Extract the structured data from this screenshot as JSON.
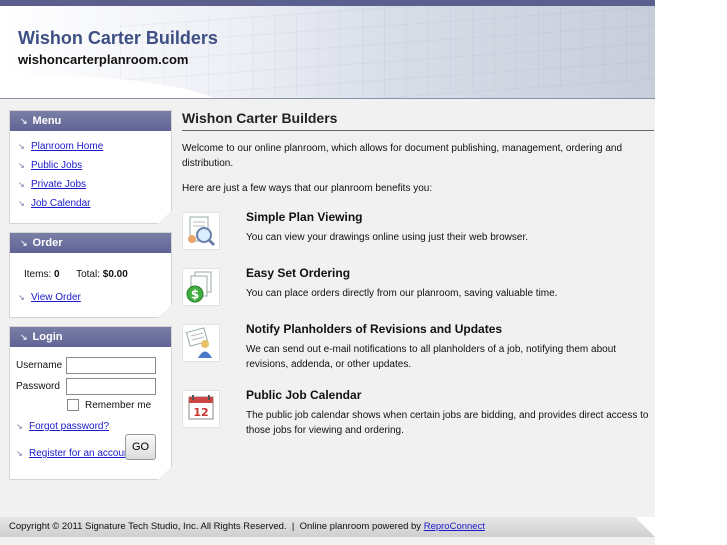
{
  "header": {
    "title": "Wishon Carter Builders",
    "url": "wishoncarterplanroom.com"
  },
  "menu": {
    "title": "Menu",
    "items": [
      {
        "label": "Planroom Home"
      },
      {
        "label": "Public Jobs"
      },
      {
        "label": "Private Jobs"
      },
      {
        "label": "Job Calendar"
      }
    ]
  },
  "order": {
    "title": "Order",
    "items_label": "Items:",
    "items_value": "0",
    "total_label": "Total:",
    "total_value": "$0.00",
    "view_order": "View Order"
  },
  "login": {
    "title": "Login",
    "username_label": "Username",
    "password_label": "Password",
    "username_value": "",
    "password_value": "",
    "remember_label": "Remember me",
    "forgot_label": "Forgot password?",
    "go_label": "GO",
    "register_label": "Register for an account"
  },
  "main": {
    "heading": "Wishon Carter Builders",
    "intro": "Welcome to our online planroom, which allows for document publishing, management, ordering and distribution.",
    "intro2": "Here are just a few ways that our planroom benefits you:",
    "features": [
      {
        "icon": "magnifier-document-icon",
        "title": "Simple Plan Viewing",
        "desc": "You can view your drawings online using just their web browser."
      },
      {
        "icon": "dollar-documents-icon",
        "title": "Easy Set Ordering",
        "desc": "You can place orders directly from our planroom, saving valuable time."
      },
      {
        "icon": "notify-person-icon",
        "title": "Notify Planholders of Revisions and Updates",
        "desc": "We can send out e-mail notifications to all planholders of a job, notifying them about revisions, addenda, or other updates."
      },
      {
        "icon": "calendar-icon",
        "title": "Public Job Calendar",
        "desc": "The public job calendar shows when certain jobs are bidding, and provides direct access to those jobs for viewing and ordering."
      }
    ]
  },
  "footer": {
    "copyright": "Copyright © 2011 Signature Tech Studio, Inc. All Rights Reserved.",
    "separator": "|",
    "powered_label": "Online planroom powered by",
    "powered_link": "ReproConnect"
  },
  "colors": {
    "brand": "#3e4f84",
    "box_header": "#6a6f9c",
    "link": "#1a1acc"
  }
}
